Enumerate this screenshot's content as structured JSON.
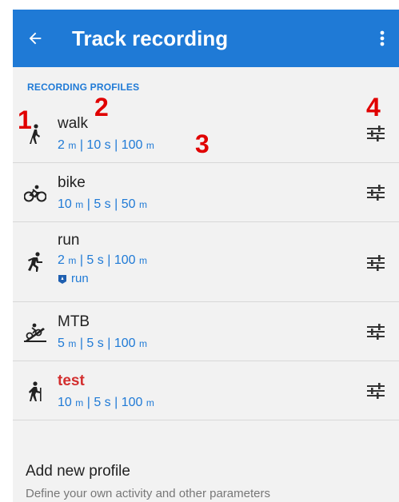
{
  "appbar": {
    "title": "Track recording",
    "back_icon": "arrow-left-icon",
    "menu_icon": "more-vert-icon",
    "color": "#1f7ad6"
  },
  "section": {
    "header": "RECORDING PROFILES"
  },
  "profiles": [
    {
      "name": "walk",
      "icon": "walk-icon",
      "v1": "2",
      "u1": "m",
      "v2": "10 s",
      "v3": "100",
      "u3": "m"
    },
    {
      "name": "bike",
      "icon": "bike-icon",
      "v1": "10",
      "u1": "m",
      "v2": "5 s",
      "v3": "50",
      "u3": "m"
    },
    {
      "name": "run",
      "icon": "run-icon",
      "v1": "2",
      "u1": "m",
      "v2": "5 s",
      "v3": "100",
      "u3": "m",
      "extra": "run"
    },
    {
      "name": "MTB",
      "icon": "mtb-icon",
      "v1": "5",
      "u1": "m",
      "v2": "5 s",
      "v3": "100",
      "u3": "m"
    },
    {
      "name": "test",
      "icon": "hike-icon",
      "v1": "10",
      "u1": "m",
      "v2": "5 s",
      "v3": "100",
      "u3": "m",
      "name_color": "#d32f2f"
    }
  ],
  "params_separator": "|",
  "add": {
    "title": "Add new profile",
    "subtitle": "Define your own activity and other parameters"
  },
  "annotations": [
    "1",
    "2",
    "3",
    "4"
  ]
}
